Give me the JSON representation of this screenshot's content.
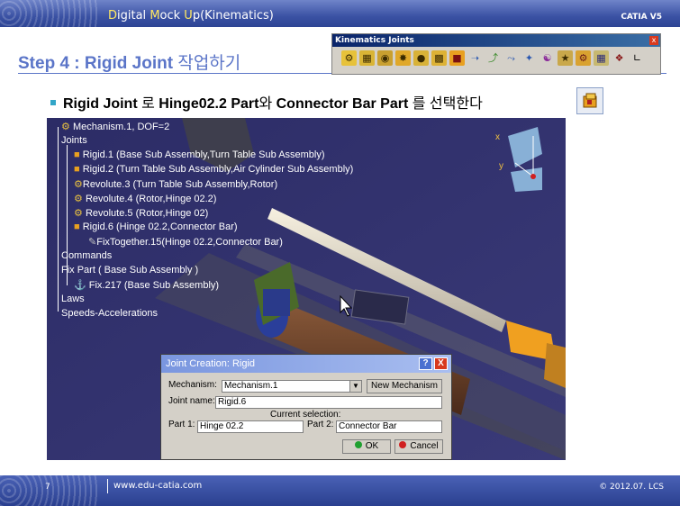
{
  "header": {
    "title_parts": [
      "D",
      "igital ",
      "M",
      "ock ",
      "U",
      "p(Kinematics)"
    ],
    "brand": "CATIA V5"
  },
  "slide": {
    "step_title_bold": "Step 4 : Rigid Joint",
    "step_title_korean": " 작업하기",
    "bullet": {
      "p1": "Rigid Joint",
      "p2": " 로 ",
      "p3": "Hinge02.2 Part",
      "p4": "와 ",
      "p5": "Connector Bar  Part",
      "p6": " 를 선택한다"
    }
  },
  "toolbar": {
    "title": "Kinematics Joints",
    "close": "x",
    "icons": [
      "revolute-joint-icon",
      "prismatic-joint-icon",
      "cylindrical-joint-icon",
      "screw-joint-icon",
      "spherical-joint-icon",
      "planar-joint-icon",
      "rigid-joint-icon",
      "point-curve-joint-icon",
      "slide-curve-joint-icon",
      "roll-curve-joint-icon",
      "point-surface-joint-icon",
      "universal-joint-icon",
      "cv-joint-icon",
      "gear-joint-icon",
      "rack-joint-icon",
      "cable-joint-icon",
      "axis-joint-icon"
    ]
  },
  "tree": {
    "items": [
      "Mechanism.1, DOF=2",
      "Joints",
      "Rigid.1 (Base Sub Assembly,Turn Table Sub Assembly)",
      "Rigid.2 (Turn Table Sub Assembly,Air Cylinder Sub Assembly)",
      "Revolute.3 (Turn Table Sub Assembly,Rotor)",
      "Revolute.4 (Rotor,Hinge 02.2)",
      "Revolute.5 (Rotor,Hinge 02)",
      "Rigid.6 (Hinge 02.2,Connector Bar)",
      "FixTogether.15(Hinge 02.2,Connector Bar)",
      "Commands",
      "Fix Part ( Base Sub Assembly )",
      "Fix.217 (Base Sub Assembly)",
      "Laws",
      "Speeds-Accelerations"
    ],
    "axis_x": "x",
    "axis_y": "y"
  },
  "dialog": {
    "title": "Joint Creation: Rigid",
    "help": "?",
    "close": "X",
    "mechanism_label": "Mechanism:",
    "mechanism_value": "Mechanism.1",
    "new_mechanism": "New Mechanism",
    "joint_name_label": "Joint name:",
    "joint_name_value": "Rigid.6",
    "current_selection": "Current selection:",
    "part1_label": "Part 1:",
    "part1_value": "Hinge 02.2",
    "part2_label": "Part 2:",
    "part2_value": "Connector Bar",
    "ok": "OK",
    "cancel": "Cancel"
  },
  "footer": {
    "page": "7",
    "url": "www.edu-catia.com",
    "copyright": "© 2012.07. LCS"
  }
}
